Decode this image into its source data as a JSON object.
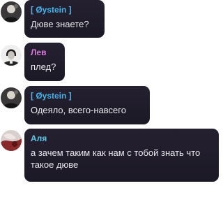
{
  "messages": [
    {
      "author": "[ Øystein ]",
      "name_color": "#42b4ee",
      "avatar": "avatar-oystein",
      "text": "Дюве знаете?"
    },
    {
      "author": "Лев",
      "name_color": "#d87ad8",
      "avatar": "avatar-lev",
      "text": "плед?"
    },
    {
      "author": "[ Øystein ]",
      "name_color": "#42b4ee",
      "avatar": "avatar-oystein",
      "text": "Одеяло, всего-навсего"
    },
    {
      "author": "Аля",
      "name_color": "#5cc8e8",
      "avatar": "avatar-alya",
      "text": "а зачем таким как нам с тобой знать что такое дюве"
    }
  ],
  "colors": {
    "bubble": "#211e2b",
    "text": "#e9e8ee",
    "background": "#ffffff"
  }
}
